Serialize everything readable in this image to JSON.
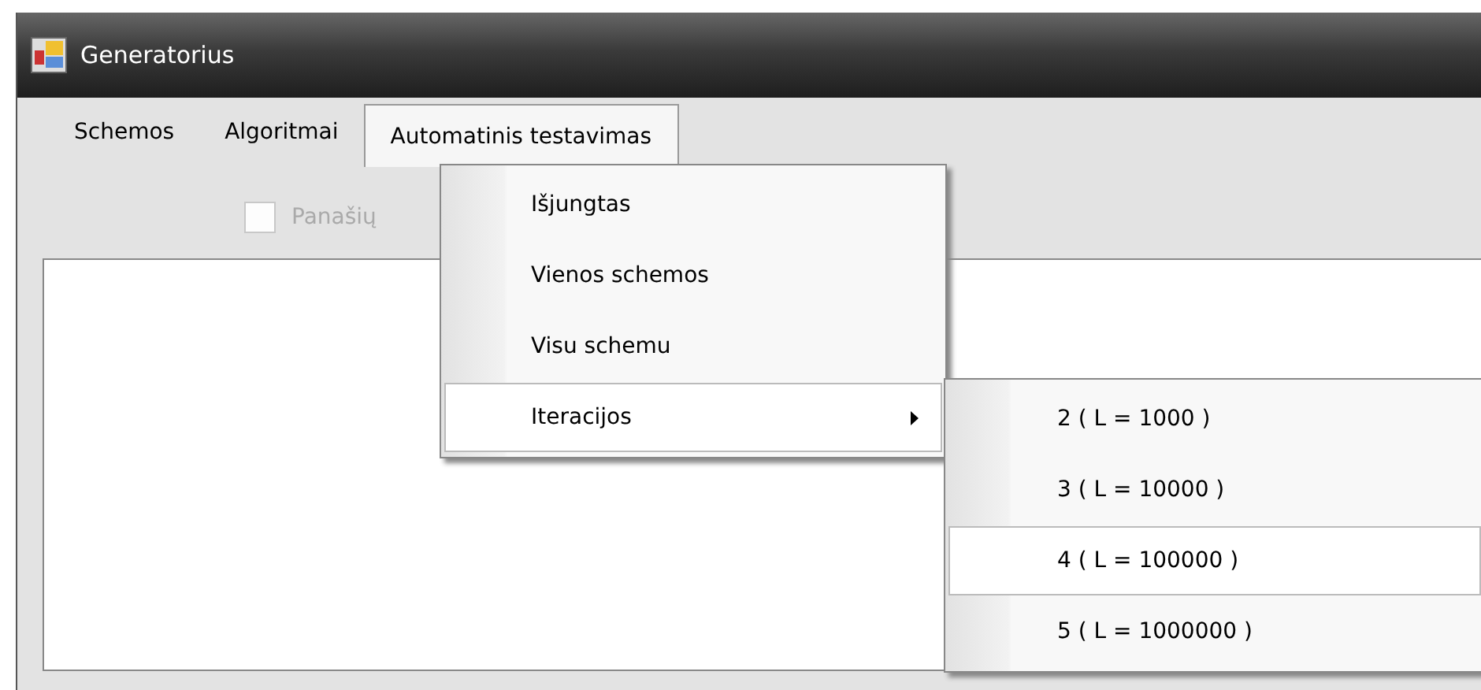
{
  "window": {
    "title": "Generatorius"
  },
  "menu_bar": [
    {
      "label": "Schemos",
      "selected": false
    },
    {
      "label": "Algoritmai",
      "selected": false
    },
    {
      "label": "Automatinis testavimas",
      "selected": true
    }
  ],
  "checkbox": {
    "label": "Panašių",
    "checked": false,
    "disabled": true
  },
  "dropdown": [
    {
      "label": "Išjungtas",
      "selected": false,
      "submenu": false
    },
    {
      "label": "Vienos schemos",
      "selected": false,
      "submenu": false
    },
    {
      "label": "Visu schemu",
      "selected": false,
      "submenu": false
    },
    {
      "label": "Iteracijos",
      "selected": true,
      "submenu": true
    }
  ],
  "submenu": [
    {
      "label": "2 ( L = 1000 )",
      "selected": false
    },
    {
      "label": "3 ( L = 10000 )",
      "selected": false
    },
    {
      "label": "4 ( L = 100000 )",
      "selected": true
    },
    {
      "label": "5 ( L = 1000000 )",
      "selected": false
    }
  ]
}
